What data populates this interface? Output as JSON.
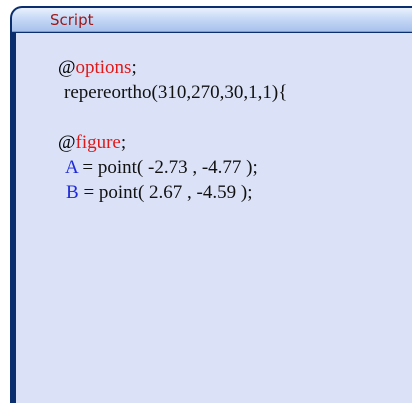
{
  "panel": {
    "title": "Script",
    "accent_color": "#0b2e6e",
    "background_color": "#dbe2f7"
  },
  "script": {
    "lines": [
      {
        "kind": "directive",
        "at": "@",
        "keyword": "options",
        "suffix": ";"
      },
      {
        "kind": "code",
        "text": "repereortho(310,270,30,1,1){"
      },
      {
        "kind": "blank"
      },
      {
        "kind": "directive",
        "at": "@",
        "keyword": "figure",
        "suffix": ";"
      },
      {
        "kind": "assign",
        "var": "A",
        "rest": " = point( -2.73 , -4.77 );"
      },
      {
        "kind": "assign",
        "var": "B",
        "rest": " = point( 2.67 , -4.59 );"
      }
    ],
    "colors": {
      "directive_keyword": "#e01818",
      "variable": "#1f2bd8",
      "text": "#111111"
    }
  }
}
